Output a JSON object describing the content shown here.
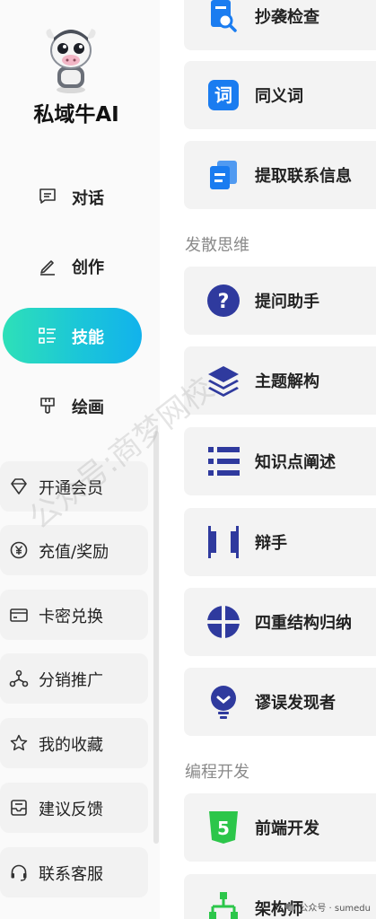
{
  "brand": {
    "name": "私域牛AI"
  },
  "nav": [
    {
      "label": "对话",
      "icon": "chat-icon"
    },
    {
      "label": "创作",
      "icon": "pen-icon"
    },
    {
      "label": "技能",
      "icon": "skills-list-icon",
      "active": true
    },
    {
      "label": "绘画",
      "icon": "brush-icon"
    }
  ],
  "menu": [
    {
      "label": "开通会员",
      "icon": "diamond-icon"
    },
    {
      "label": "充值/奖励",
      "icon": "yen-coin-icon"
    },
    {
      "label": "卡密兑换",
      "icon": "card-icon"
    },
    {
      "label": "分销推广",
      "icon": "share-network-icon"
    },
    {
      "label": "我的收藏",
      "icon": "star-icon"
    },
    {
      "label": "建议反馈",
      "icon": "inbox-icon"
    },
    {
      "label": "联系客服",
      "icon": "headset-icon"
    }
  ],
  "skills_top": [
    {
      "label": "抄袭检查",
      "icon": "document-search-icon"
    },
    {
      "label": "同义词",
      "icon": "word-icon"
    },
    {
      "label": "提取联系信息",
      "icon": "copy-documents-icon"
    }
  ],
  "section_divergent": "发散思维",
  "skills_divergent": [
    {
      "label": "提问助手",
      "icon": "question-icon"
    },
    {
      "label": "主题解构",
      "icon": "layers-icon"
    },
    {
      "label": "知识点阐述",
      "icon": "bullet-list-icon"
    },
    {
      "label": "辩手",
      "icon": "debate-bars-icon"
    },
    {
      "label": "四重结构归纳",
      "icon": "quadrant-icon"
    },
    {
      "label": "谬误发现者",
      "icon": "lightbulb-icon"
    }
  ],
  "section_coding": "编程开发",
  "skills_coding": [
    {
      "label": "前端开发",
      "icon": "html5-icon"
    },
    {
      "label": "架构师",
      "icon": "architecture-tree-icon"
    }
  ],
  "watermark": "公众号:商梦网校",
  "wechat_tag": "公众号 · sumedu",
  "colors": {
    "accent_start": "#2ee0b8",
    "accent_end": "#12b2ec",
    "skill_blue": "#1a7cf0",
    "skill_navy": "#2f3a9e",
    "html5_green": "#2cc64a"
  }
}
